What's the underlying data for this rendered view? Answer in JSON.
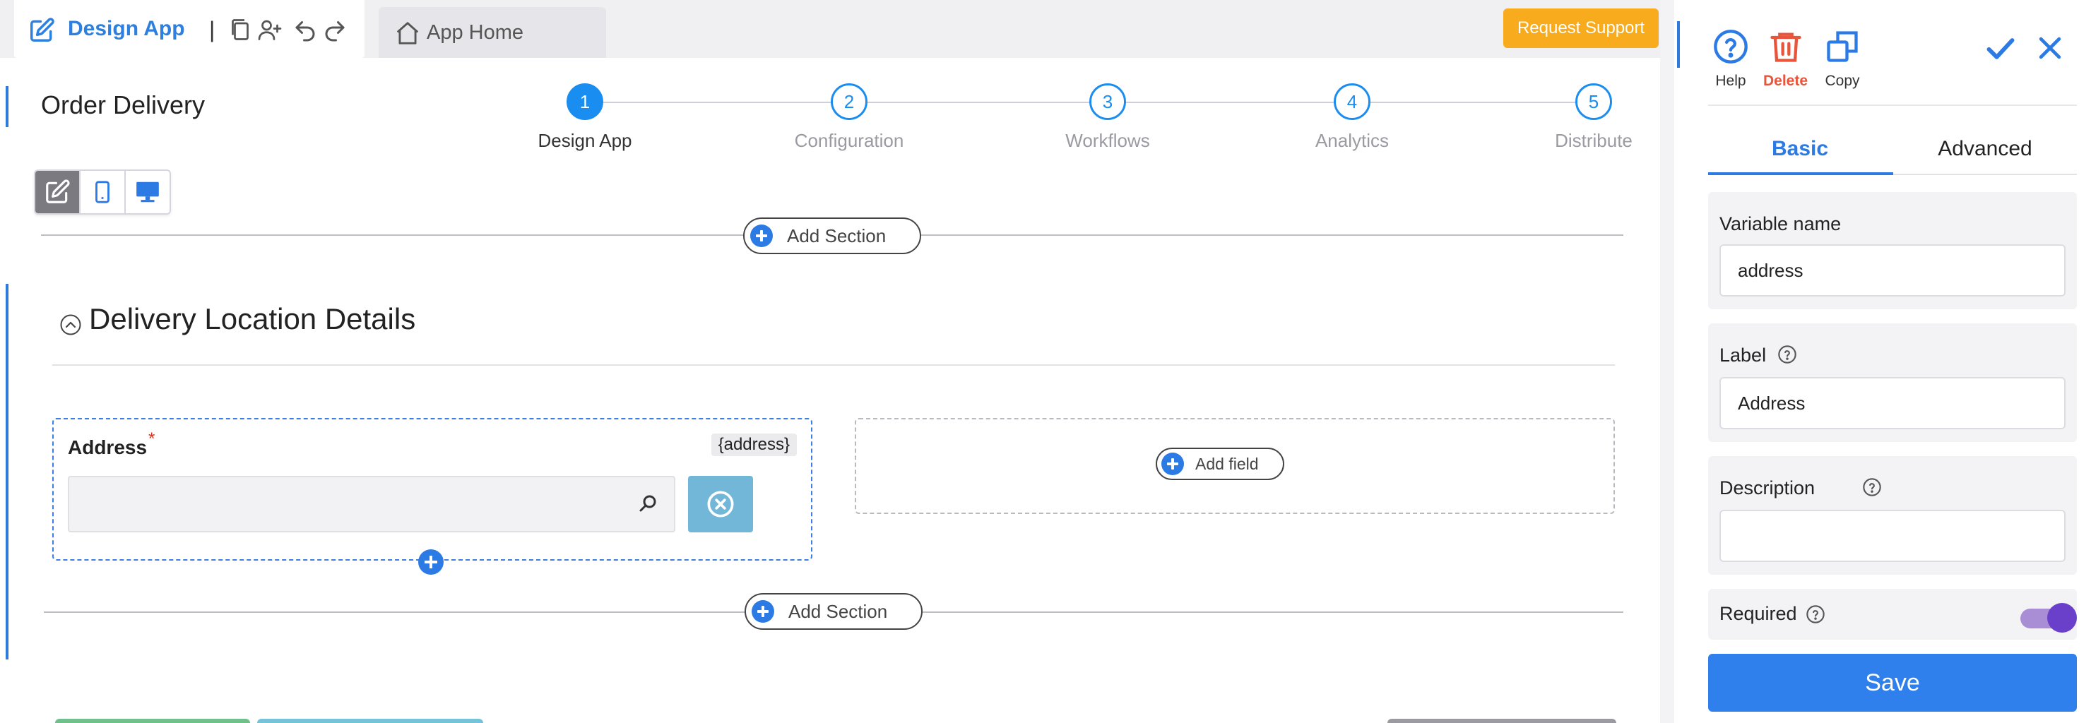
{
  "app": {
    "title": "Design App"
  },
  "toolbar": {
    "separator": "|",
    "home_label": "App Home",
    "support_label": "Request Support"
  },
  "page": {
    "title": "Order Delivery"
  },
  "steps": [
    {
      "number": "1",
      "label": "Design App",
      "active": true
    },
    {
      "number": "2",
      "label": "Configuration",
      "active": false
    },
    {
      "number": "3",
      "label": "Workflows",
      "active": false
    },
    {
      "number": "4",
      "label": "Analytics",
      "active": false
    },
    {
      "number": "5",
      "label": "Distribute",
      "active": false
    }
  ],
  "add_section_label": "Add Section",
  "section": {
    "title": "Delivery Location Details",
    "field": {
      "label": "Address",
      "required_mark": "*",
      "variable_badge": "{address}",
      "value": "",
      "placeholder": ""
    },
    "add_field_label": "Add field"
  },
  "panel": {
    "tools": {
      "help": "Help",
      "delete": "Delete",
      "copy": "Copy"
    },
    "tabs": {
      "basic": "Basic",
      "advanced": "Advanced"
    },
    "variable_name": {
      "label": "Variable name",
      "value": "address"
    },
    "label_field": {
      "label": "Label",
      "value": "Address"
    },
    "description": {
      "label": "Description",
      "value": ""
    },
    "required": {
      "label": "Required",
      "on": true
    },
    "save_label": "Save"
  },
  "colors": {
    "accent": "#2c7be5",
    "support": "#f9ab1e",
    "delete": "#e8553a",
    "toggle": "#6a3fc9",
    "clear_button": "#73b7d8"
  }
}
